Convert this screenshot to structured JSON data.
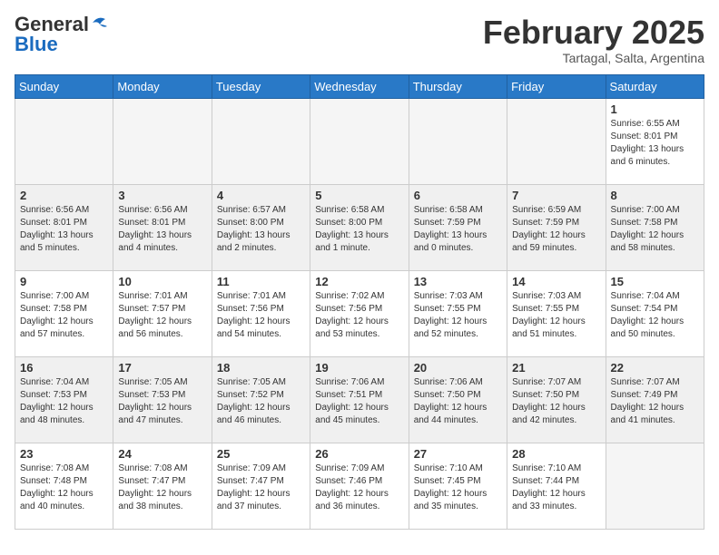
{
  "header": {
    "logo_general": "General",
    "logo_blue": "Blue",
    "month_title": "February 2025",
    "location": "Tartagal, Salta, Argentina"
  },
  "weekdays": [
    "Sunday",
    "Monday",
    "Tuesday",
    "Wednesday",
    "Thursday",
    "Friday",
    "Saturday"
  ],
  "weeks": [
    [
      {
        "day": "",
        "info": ""
      },
      {
        "day": "",
        "info": ""
      },
      {
        "day": "",
        "info": ""
      },
      {
        "day": "",
        "info": ""
      },
      {
        "day": "",
        "info": ""
      },
      {
        "day": "",
        "info": ""
      },
      {
        "day": "1",
        "info": "Sunrise: 6:55 AM\nSunset: 8:01 PM\nDaylight: 13 hours\nand 6 minutes."
      }
    ],
    [
      {
        "day": "2",
        "info": "Sunrise: 6:56 AM\nSunset: 8:01 PM\nDaylight: 13 hours\nand 5 minutes."
      },
      {
        "day": "3",
        "info": "Sunrise: 6:56 AM\nSunset: 8:01 PM\nDaylight: 13 hours\nand 4 minutes."
      },
      {
        "day": "4",
        "info": "Sunrise: 6:57 AM\nSunset: 8:00 PM\nDaylight: 13 hours\nand 2 minutes."
      },
      {
        "day": "5",
        "info": "Sunrise: 6:58 AM\nSunset: 8:00 PM\nDaylight: 13 hours\nand 1 minute."
      },
      {
        "day": "6",
        "info": "Sunrise: 6:58 AM\nSunset: 7:59 PM\nDaylight: 13 hours\nand 0 minutes."
      },
      {
        "day": "7",
        "info": "Sunrise: 6:59 AM\nSunset: 7:59 PM\nDaylight: 12 hours\nand 59 minutes."
      },
      {
        "day": "8",
        "info": "Sunrise: 7:00 AM\nSunset: 7:58 PM\nDaylight: 12 hours\nand 58 minutes."
      }
    ],
    [
      {
        "day": "9",
        "info": "Sunrise: 7:00 AM\nSunset: 7:58 PM\nDaylight: 12 hours\nand 57 minutes."
      },
      {
        "day": "10",
        "info": "Sunrise: 7:01 AM\nSunset: 7:57 PM\nDaylight: 12 hours\nand 56 minutes."
      },
      {
        "day": "11",
        "info": "Sunrise: 7:01 AM\nSunset: 7:56 PM\nDaylight: 12 hours\nand 54 minutes."
      },
      {
        "day": "12",
        "info": "Sunrise: 7:02 AM\nSunset: 7:56 PM\nDaylight: 12 hours\nand 53 minutes."
      },
      {
        "day": "13",
        "info": "Sunrise: 7:03 AM\nSunset: 7:55 PM\nDaylight: 12 hours\nand 52 minutes."
      },
      {
        "day": "14",
        "info": "Sunrise: 7:03 AM\nSunset: 7:55 PM\nDaylight: 12 hours\nand 51 minutes."
      },
      {
        "day": "15",
        "info": "Sunrise: 7:04 AM\nSunset: 7:54 PM\nDaylight: 12 hours\nand 50 minutes."
      }
    ],
    [
      {
        "day": "16",
        "info": "Sunrise: 7:04 AM\nSunset: 7:53 PM\nDaylight: 12 hours\nand 48 minutes."
      },
      {
        "day": "17",
        "info": "Sunrise: 7:05 AM\nSunset: 7:53 PM\nDaylight: 12 hours\nand 47 minutes."
      },
      {
        "day": "18",
        "info": "Sunrise: 7:05 AM\nSunset: 7:52 PM\nDaylight: 12 hours\nand 46 minutes."
      },
      {
        "day": "19",
        "info": "Sunrise: 7:06 AM\nSunset: 7:51 PM\nDaylight: 12 hours\nand 45 minutes."
      },
      {
        "day": "20",
        "info": "Sunrise: 7:06 AM\nSunset: 7:50 PM\nDaylight: 12 hours\nand 44 minutes."
      },
      {
        "day": "21",
        "info": "Sunrise: 7:07 AM\nSunset: 7:50 PM\nDaylight: 12 hours\nand 42 minutes."
      },
      {
        "day": "22",
        "info": "Sunrise: 7:07 AM\nSunset: 7:49 PM\nDaylight: 12 hours\nand 41 minutes."
      }
    ],
    [
      {
        "day": "23",
        "info": "Sunrise: 7:08 AM\nSunset: 7:48 PM\nDaylight: 12 hours\nand 40 minutes."
      },
      {
        "day": "24",
        "info": "Sunrise: 7:08 AM\nSunset: 7:47 PM\nDaylight: 12 hours\nand 38 minutes."
      },
      {
        "day": "25",
        "info": "Sunrise: 7:09 AM\nSunset: 7:47 PM\nDaylight: 12 hours\nand 37 minutes."
      },
      {
        "day": "26",
        "info": "Sunrise: 7:09 AM\nSunset: 7:46 PM\nDaylight: 12 hours\nand 36 minutes."
      },
      {
        "day": "27",
        "info": "Sunrise: 7:10 AM\nSunset: 7:45 PM\nDaylight: 12 hours\nand 35 minutes."
      },
      {
        "day": "28",
        "info": "Sunrise: 7:10 AM\nSunset: 7:44 PM\nDaylight: 12 hours\nand 33 minutes."
      },
      {
        "day": "",
        "info": ""
      }
    ]
  ]
}
